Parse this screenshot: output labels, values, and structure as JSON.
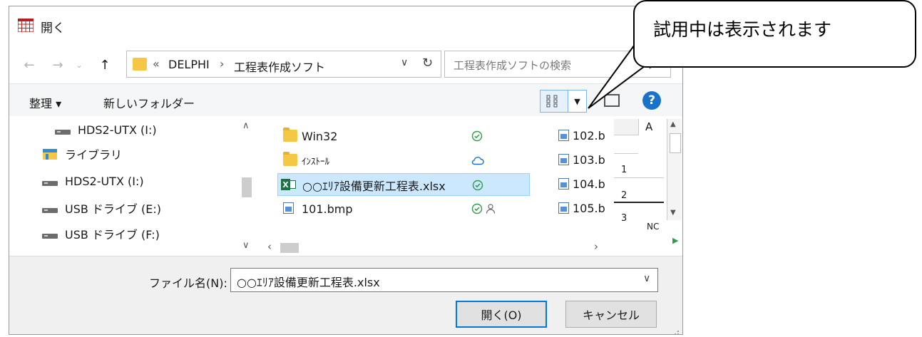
{
  "dialog": {
    "title": "開く"
  },
  "nav": {
    "address_prefix": "«",
    "breadcrumb": [
      "DELPHI",
      "工程表作成ソフト"
    ],
    "breadcrumb_sep": "›",
    "search_placeholder": "工程表作成ソフトの検索"
  },
  "toolbar": {
    "organize_label": "整理 ▾",
    "new_folder_label": "新しいフォルダー"
  },
  "sidebar": {
    "items": [
      {
        "label": "HDS2-UTX (I:)",
        "icon": "drive-icon"
      },
      {
        "label": "ライブラリ",
        "icon": "library-icon"
      },
      {
        "label": "HDS2-UTX (I:)",
        "icon": "drive-icon"
      },
      {
        "label": "USB ドライブ (E:)",
        "icon": "drive-icon"
      },
      {
        "label": "USB ドライブ (F:)",
        "icon": "drive-icon"
      }
    ]
  },
  "files": [
    {
      "name": "Win32",
      "type": "folder",
      "status": "synced"
    },
    {
      "name": "ｲﾝｽﾄｰﾙ",
      "type": "folder",
      "status": "cloud"
    },
    {
      "name": "○○ｴﾘｱ設備更新工程表.xlsx",
      "type": "excel",
      "status": "synced",
      "selected": true
    },
    {
      "name": "101.bmp",
      "type": "image",
      "status": "synced-shared"
    }
  ],
  "files_col2": [
    "102.b",
    "103.b",
    "104.b",
    "105.b"
  ],
  "sheet": {
    "col_header": "A",
    "rows": [
      "1",
      "2",
      "3"
    ],
    "partial": "NC"
  },
  "bottom": {
    "filename_label": "ファイル名(N):",
    "filename_value": "○○ｴﾘｱ設備更新工程表.xlsx",
    "open_label": "開く(O)",
    "cancel_label": "キャンセル"
  },
  "callout": {
    "text": "試用中は表示されます"
  },
  "colors": {
    "accent": "#0078d7",
    "help": "#1a73c8",
    "selected_bg": "#cce8ff",
    "excel_green": "#1e7145",
    "sync_green": "#2e9e4a"
  }
}
